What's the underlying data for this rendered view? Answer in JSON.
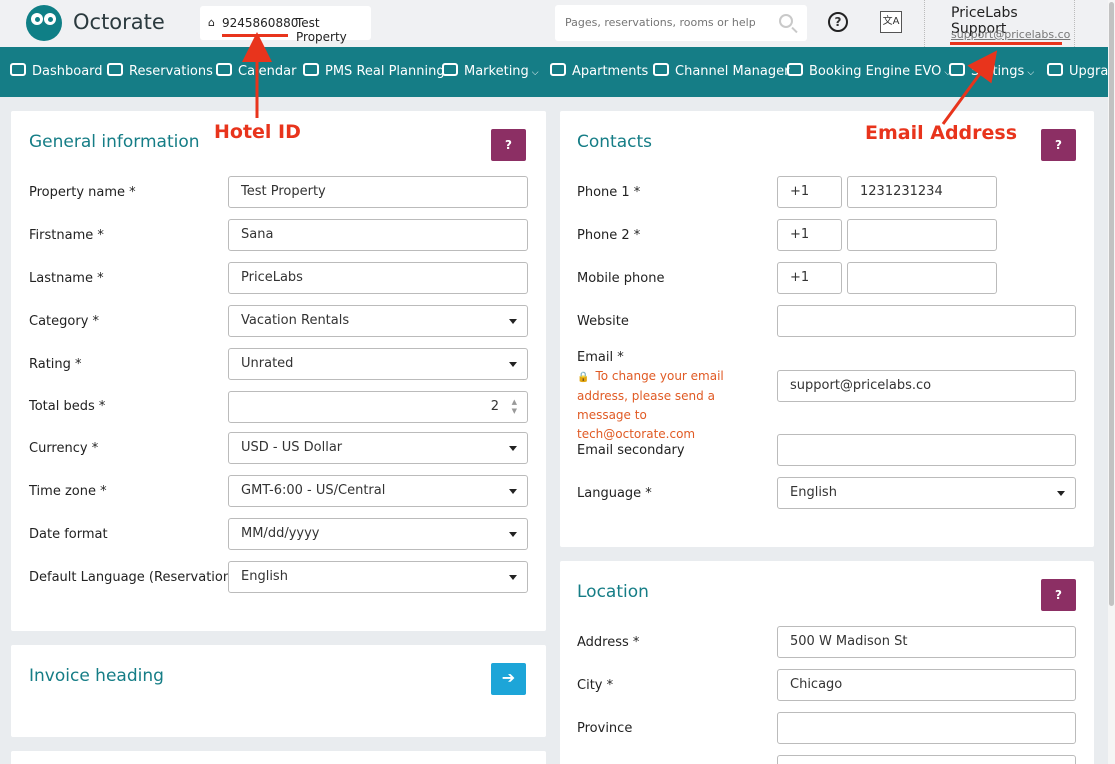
{
  "app": {
    "brand": "Octorate"
  },
  "hotel": {
    "id": "9245860880",
    "name": "Test Property"
  },
  "search": {
    "placeholder": "Pages, reservations, rooms or help"
  },
  "user": {
    "name": "PriceLabs Support",
    "email": "support@pricelabs.co"
  },
  "nav": [
    {
      "label": "Dashboard",
      "icon": "dashboard-icon"
    },
    {
      "label": "Reservations",
      "icon": "reservations-icon"
    },
    {
      "label": "Calendar",
      "icon": "calendar-icon"
    },
    {
      "label": "PMS Real Planning",
      "icon": "planning-icon"
    },
    {
      "label": "Marketing",
      "icon": "cart-icon",
      "dropdown": true
    },
    {
      "label": "Apartments",
      "icon": "home-icon"
    },
    {
      "label": "Channel Manager",
      "icon": "shuffle-icon"
    },
    {
      "label": "Booking Engine EVO",
      "icon": "monitor-icon",
      "dropdown": true
    },
    {
      "label": "Settings",
      "icon": "wrench-icon",
      "dropdown": true
    },
    {
      "label": "Upgrade",
      "icon": "card-icon"
    }
  ],
  "general": {
    "title": "General information",
    "help": "?",
    "fields": {
      "property_name": {
        "label": "Property name  *",
        "value": "Test Property"
      },
      "firstname": {
        "label": "Firstname  *",
        "value": "Sana"
      },
      "lastname": {
        "label": "Lastname  *",
        "value": "PriceLabs"
      },
      "category": {
        "label": "Category  *",
        "value": "Vacation Rentals"
      },
      "rating": {
        "label": "Rating  *",
        "value": "Unrated"
      },
      "total_beds": {
        "label": "Total beds  *",
        "value": "2"
      },
      "currency": {
        "label": "Currency  *",
        "value": "USD - US Dollar"
      },
      "timezone": {
        "label": "Time zone  *",
        "value": "GMT-6:00 - US/Central"
      },
      "date_format": {
        "label": "Date format",
        "value": "MM/dd/yyyy"
      },
      "default_language": {
        "label": "Default Language (Reservation)",
        "value": "English"
      }
    }
  },
  "invoice": {
    "title": "Invoice heading"
  },
  "contacts": {
    "title": "Contacts",
    "help": "?",
    "phone1": {
      "label": "Phone 1  *",
      "prefix": "+1",
      "value": "1231231234"
    },
    "phone2": {
      "label": "Phone 2  *",
      "prefix": "+1",
      "value": ""
    },
    "mobile": {
      "label": "Mobile phone",
      "prefix": "+1",
      "value": ""
    },
    "website": {
      "label": "Website",
      "value": ""
    },
    "email": {
      "label": "Email  *",
      "value": "support@pricelabs.co",
      "note": "To change your email address, please send a message to tech@octorate.com"
    },
    "email_secondary": {
      "label": "Email secondary",
      "value": ""
    },
    "language": {
      "label": "Language  *",
      "value": "English"
    }
  },
  "location": {
    "title": "Location",
    "help": "?",
    "address": {
      "label": "Address  *",
      "value": "500 W Madison St"
    },
    "city": {
      "label": "City  *",
      "value": "Chicago"
    },
    "province": {
      "label": "Province",
      "value": ""
    }
  },
  "annotations": {
    "hotel_id": "Hotel ID",
    "email_address": "Email Address"
  },
  "colors": {
    "primary": "#157d86",
    "help_button": "#8c2f64",
    "annotation": "#e8341c",
    "info_button": "#1da5d8"
  }
}
